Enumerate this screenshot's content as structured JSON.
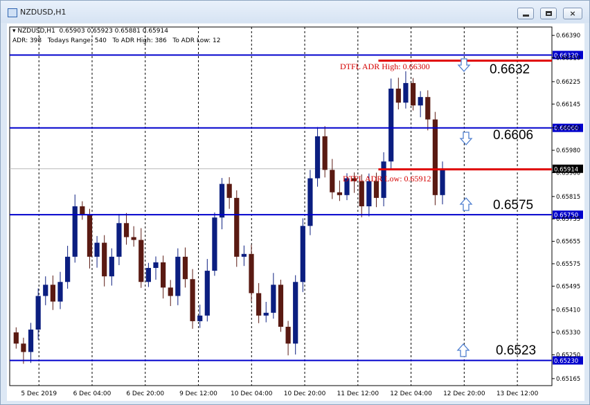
{
  "window": {
    "title": "NZDUSD,H1",
    "minimize_icon": "minimize-icon",
    "maximize_icon": "maximize-icon",
    "close_icon": "close-icon",
    "close_glyph": "×"
  },
  "hud": {
    "symbol_line": "▾ NZDUSD,H1  0.65903 0.65923 0.65881 0.65914",
    "adr_line": "ADR: 398   Todays Range: 540   To ADR High: 386   To ADR Low: 12"
  },
  "colors": {
    "bull": "#0b1e80",
    "bear": "#5a1a12",
    "level_line": "#0000cc",
    "adr_line": "#e00000",
    "arrow": "#4f7fd0"
  },
  "annotations": {
    "adr_high_text": "DTFL ADR High: 0.66300",
    "adr_low_text": "DTFL ADR Low: 0.65912",
    "level_labels": [
      "0.6632",
      "0.6606",
      "0.6575",
      "0.6523"
    ],
    "arrows": [
      "down",
      "down",
      "up",
      "up"
    ]
  },
  "chart_data": {
    "type": "candlestick",
    "symbol": "NZDUSD",
    "timeframe": "H1",
    "ylim": [
      0.6514,
      0.6642
    ],
    "y_ticks": [
      "0.66390",
      "0.66310",
      "0.66225",
      "0.66145",
      "0.66060",
      "0.65980",
      "0.65900",
      "0.65815",
      "0.65735",
      "0.65655",
      "0.65575",
      "0.65495",
      "0.65410",
      "0.65330",
      "0.65250",
      "0.65165"
    ],
    "x_ticks": [
      "5 Dec 2019",
      "6 Dec 04:00",
      "6 Dec 20:00",
      "9 Dec 12:00",
      "10 Dec 04:00",
      "10 Dec 20:00",
      "11 Dec 12:00",
      "12 Dec 04:00",
      "12 Dec 20:00",
      "13 Dec 12:00"
    ],
    "current_price": "0.65914",
    "horizontal_levels": [
      {
        "price": 0.6632,
        "label": "0.66320",
        "kind": "resistance"
      },
      {
        "price": 0.6606,
        "label": "0.66060",
        "kind": "resistance"
      },
      {
        "price": 0.6575,
        "label": "0.65750",
        "kind": "support"
      },
      {
        "price": 0.6523,
        "label": "0.65230",
        "kind": "support"
      }
    ],
    "adr_high": 0.663,
    "adr_low": 0.65912,
    "close_path": [
      0.6529,
      0.6526,
      0.6534,
      0.6546,
      0.655,
      0.6544,
      0.6551,
      0.656,
      0.6578,
      0.6575,
      0.656,
      0.6565,
      0.6553,
      0.656,
      0.6572,
      0.6567,
      0.6566,
      0.6551,
      0.6556,
      0.6558,
      0.6549,
      0.6546,
      0.656,
      0.6552,
      0.6537,
      0.6539,
      0.6555,
      0.6574,
      0.6586,
      0.6581,
      0.656,
      0.6561,
      0.6547,
      0.6539,
      0.654,
      0.655,
      0.6535,
      0.6529,
      0.6551,
      0.6571,
      0.6588,
      0.6603,
      0.6591,
      0.6583,
      0.6582,
      0.6588,
      0.6587,
      0.6578,
      0.6587,
      0.6581,
      0.6594,
      0.662,
      0.6615,
      0.6622,
      0.6614,
      0.6617,
      0.6609,
      0.6582,
      0.6591
    ]
  }
}
